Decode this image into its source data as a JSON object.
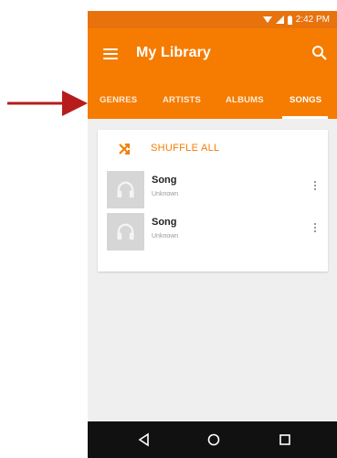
{
  "status_bar": {
    "time": "2:42 PM",
    "icons": [
      "wifi-icon",
      "signal-icon",
      "battery-icon"
    ]
  },
  "app_bar": {
    "title": "My Library",
    "menu_icon": "menu-icon",
    "search_icon": "search-icon"
  },
  "tabs": [
    {
      "label": "GENRES",
      "active": false
    },
    {
      "label": "ARTISTS",
      "active": false
    },
    {
      "label": "ALBUMS",
      "active": false
    },
    {
      "label": "SONGS",
      "active": true
    }
  ],
  "shuffle": {
    "label": "SHUFFLE ALL",
    "icon": "shuffle-icon"
  },
  "songs": [
    {
      "title": "Song",
      "artist": "Unknown"
    },
    {
      "title": "Song",
      "artist": "Unknown"
    }
  ],
  "nav_bar": [
    "back-icon",
    "home-icon",
    "recents-icon"
  ],
  "colors": {
    "accent": "#f57c00",
    "status_bar": "#e8720c",
    "arrow": "#b71c1c",
    "background": "#efefef",
    "nav_bar": "#111111"
  }
}
